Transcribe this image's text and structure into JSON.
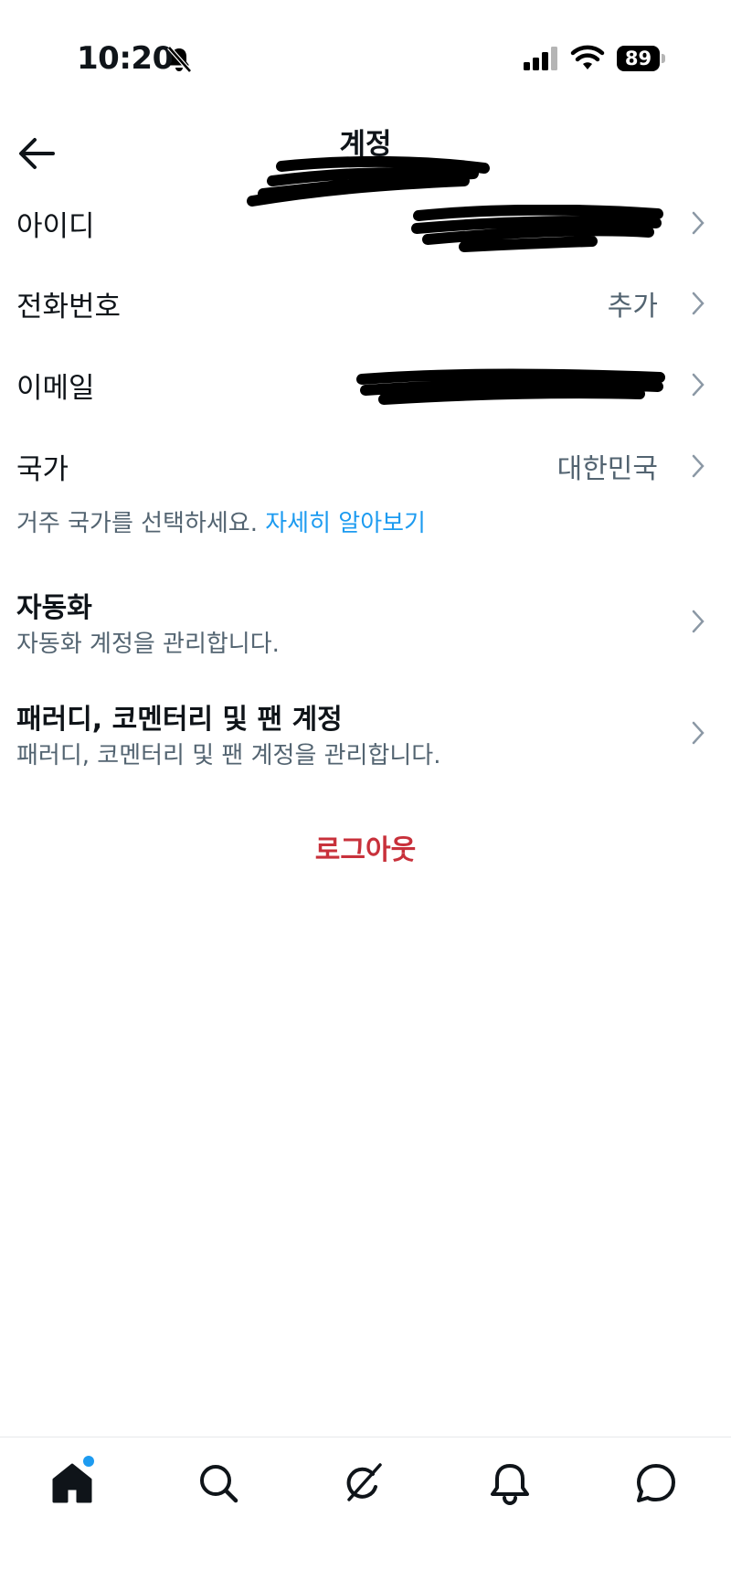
{
  "status_bar": {
    "time": "10:20",
    "battery": "89"
  },
  "header": {
    "title": "계정"
  },
  "rows": [
    {
      "label": "아이디",
      "value": ""
    },
    {
      "label": "전화번호",
      "value": "추가"
    },
    {
      "label": "이메일",
      "value": ""
    },
    {
      "label": "국가",
      "value": "대한민국"
    }
  ],
  "country_hint": {
    "text": "거주 국가를 선택하세요. ",
    "link": "자세히 알아보기"
  },
  "sections": [
    {
      "title": "자동화",
      "subtitle": "자동화 계정을 관리합니다."
    },
    {
      "title": "패러디, 코멘터리 및 팬 계정",
      "subtitle": "패러디, 코멘터리 및 팬 계정을 관리합니다."
    }
  ],
  "logout_label": "로그아웃",
  "colors": {
    "accent": "#1d9bf0",
    "logout": "#c8313b",
    "secondary_text": "#536471"
  },
  "bottom_nav": [
    "home-icon",
    "search-icon",
    "grok-icon",
    "bell-icon",
    "messages-icon"
  ]
}
